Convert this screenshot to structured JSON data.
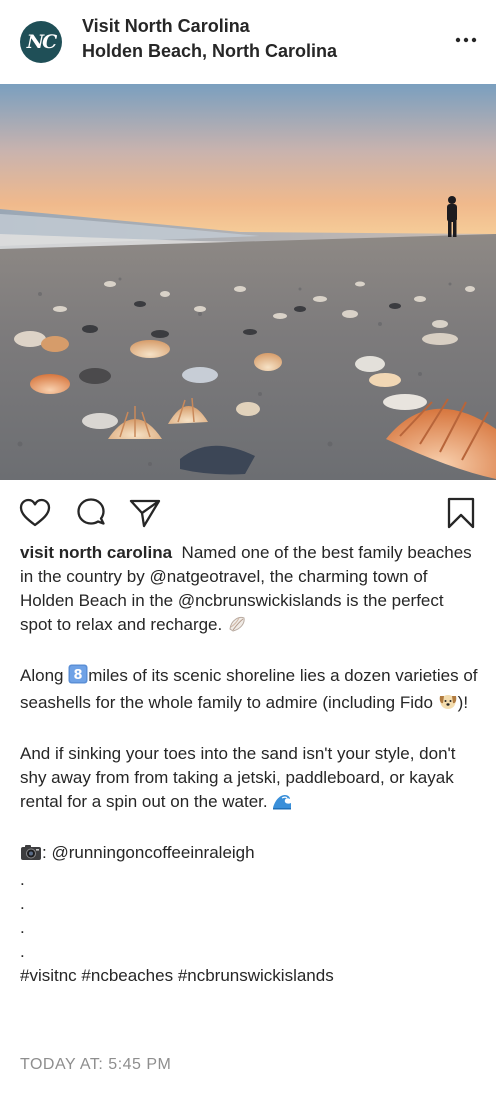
{
  "header": {
    "avatar_text": "NC",
    "account_name": "Visit North Carolina",
    "location": "Holden Beach, North Carolina",
    "more_icon": "ellipsis-icon",
    "more_label": "•••"
  },
  "photo": {
    "description_icon": "beach-photo"
  },
  "actions": {
    "like_icon": "heart-icon",
    "comment_icon": "comment-icon",
    "share_icon": "send-icon",
    "save_icon": "bookmark-icon"
  },
  "caption": {
    "username": "visit north carolina",
    "p1_text": "Named one of the best family beaches in the country by @natgeotravel, the charming town of Holden Beach in the @ncbrunswickislands is the perfect spot to relax and recharge.",
    "p2_pre": "Along",
    "p2_post": "miles of its scenic shoreline lies a dozen varieties of seashells for the whole family to admire (including Fido",
    "p2_end": ")!",
    "p3_text": "And if sinking your toes into the sand isn't your style, don't shy away from from taking a jetski, paddleboard, or kayak rental for a spin out on the water.",
    "credit": ": @runningoncoffeeinraleigh",
    "dot": ".",
    "hashtags": "#visitnc #ncbeaches #ncbrunswickislands"
  },
  "timestamp": "TODAY AT: 5:45 PM",
  "colors": {
    "avatar_bg": "#1f4f57",
    "text": "#262626",
    "muted": "#8e8e8e"
  }
}
